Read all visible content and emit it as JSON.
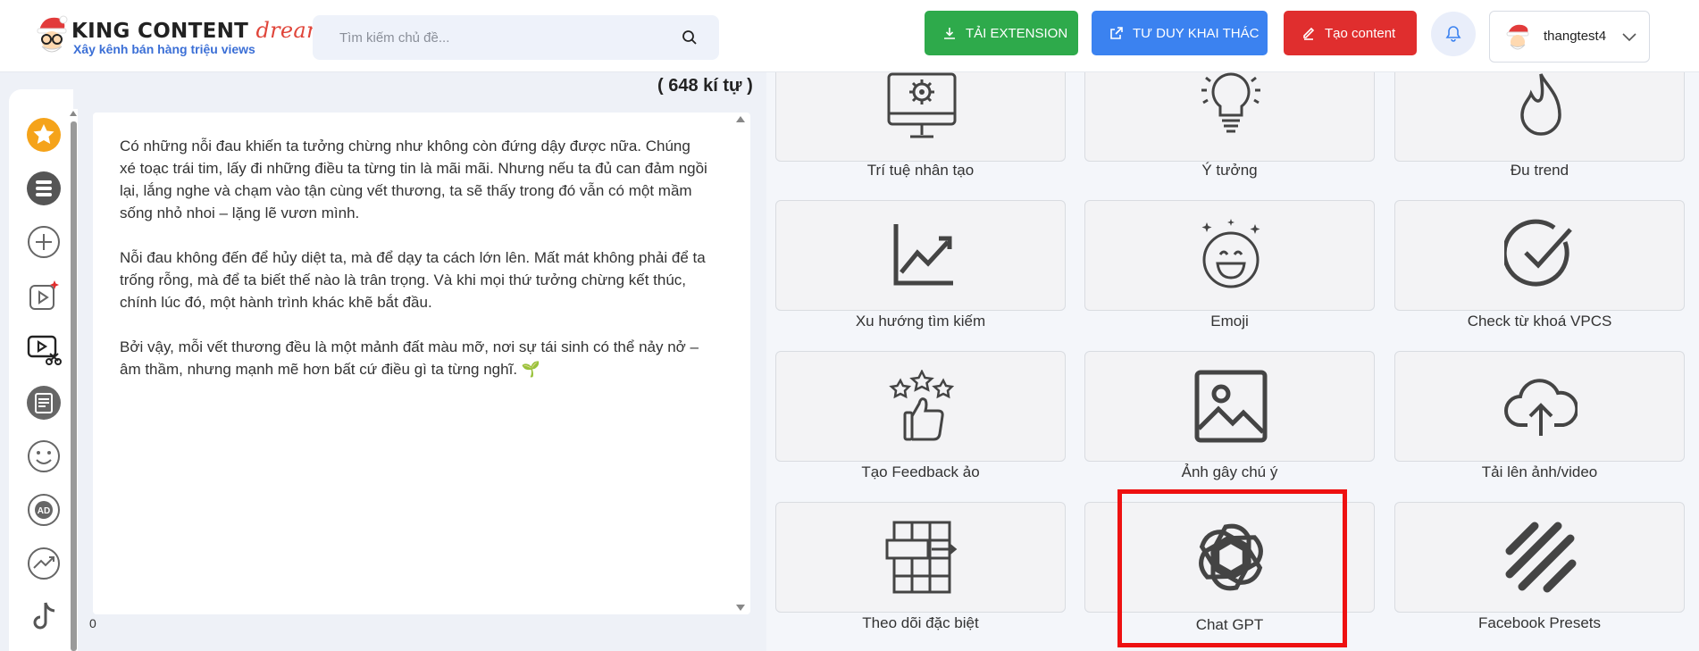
{
  "header": {
    "logo": {
      "title": "KING CONTENT",
      "title_accent": "dream",
      "subtitle": "Xây kênh bán hàng triệu views"
    },
    "search": {
      "placeholder": "Tìm kiếm chủ đề..."
    },
    "buttons": {
      "extension": "TẢI EXTENSION",
      "tuduy": "TƯ DUY KHAI THÁC",
      "tao_content": "Tạo content"
    },
    "user": {
      "name": "thangtest4"
    },
    "colors": {
      "green": "#2eaa4b",
      "blue": "#3b82f0",
      "red": "#e02e2e"
    }
  },
  "rail": {
    "icons": [
      "star-icon",
      "list-icon",
      "plus-circle-icon",
      "video-star-icon",
      "video-edit-icon",
      "document-icon",
      "smiley-icon",
      "ad-icon",
      "trend-icon",
      "tiktok-icon"
    ]
  },
  "editor": {
    "char_count": "( 648 kí tự )",
    "paragraphs": [
      "Có những nỗi đau khiến ta tưởng chừng như không còn đứng dậy được nữa. Chúng xé toạc trái tim, lấy đi những điều ta từng tin là mãi mãi. Nhưng nếu ta đủ can đảm ngồi lại, lắng nghe và chạm vào tận cùng vết thương, ta sẽ thấy trong đó vẫn có một mầm sống nhỏ nhoi – lặng lẽ vươn mình.",
      "Nỗi đau không đến để hủy diệt ta, mà để dạy ta cách lớn lên. Mất mát không phải để ta trống rỗng, mà để ta biết thế nào là trân trọng. Và khi mọi thứ tưởng chừng kết thúc, chính lúc đó, một hành trình khác khẽ bắt đầu.",
      "Bởi vậy, mỗi vết thương đều là một mảnh đất màu mỡ, nơi sự tái sinh có thể nảy nở – âm thầm, nhưng mạnh mẽ hơn bất cứ điều gì ta từng nghĩ. 🌱"
    ],
    "footer_count": "0"
  },
  "tools": [
    {
      "label": "Trí tuệ nhân tạo",
      "icon": "ai-computer-icon"
    },
    {
      "label": "Ý tưởng",
      "icon": "lightbulb-icon"
    },
    {
      "label": "Đu trend",
      "icon": "flame-icon"
    },
    {
      "label": "Xu hướng tìm kiếm",
      "icon": "trend-chart-icon"
    },
    {
      "label": "Emoji",
      "icon": "emoji-icon"
    },
    {
      "label": "Check từ khoá VPCS",
      "icon": "check-circle-icon"
    },
    {
      "label": "Tạo Feedback ảo",
      "icon": "feedback-icon"
    },
    {
      "label": "Ảnh gây chú ý",
      "icon": "image-icon"
    },
    {
      "label": "Tải lên ảnh/video",
      "icon": "cloud-upload-icon"
    },
    {
      "label": "Theo dõi đặc biệt",
      "icon": "table-track-icon"
    },
    {
      "label": "Chat GPT",
      "icon": "chatgpt-icon"
    },
    {
      "label": "Facebook Presets",
      "icon": "slashes-icon"
    }
  ]
}
